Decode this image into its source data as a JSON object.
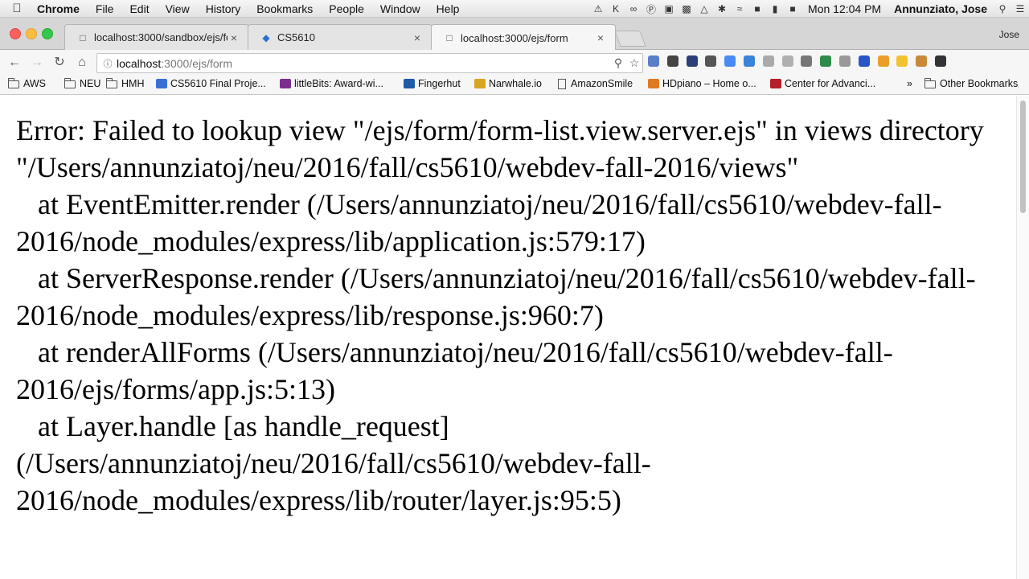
{
  "menubar": {
    "items": [
      "Chrome",
      "File",
      "Edit",
      "View",
      "History",
      "Bookmarks",
      "People",
      "Window",
      "Help"
    ],
    "clock": "Mon 12:04 PM",
    "user": "Annunziato, Jose"
  },
  "tabs": [
    {
      "title": "localhost:3000/sandbox/ejs/fo",
      "active": false
    },
    {
      "title": "CS5610",
      "active": false
    },
    {
      "title": "localhost:3000/ejs/form",
      "active": true
    }
  ],
  "profile": "Jose",
  "address": {
    "host": "localhost",
    "path": ":3000/ejs/form"
  },
  "bookmarks": [
    {
      "label": "AWS",
      "icon": "folder-icon"
    },
    {
      "label": "NEU",
      "icon": "folder-icon"
    },
    {
      "label": "HMH",
      "icon": "folder-icon"
    },
    {
      "label": "CS5610 Final Proje...",
      "icon": "docs-icon"
    },
    {
      "label": "littleBits: Award-wi...",
      "icon": "littlebits-icon"
    },
    {
      "label": "Fingerhut",
      "icon": "fingerhut-icon"
    },
    {
      "label": "Narwhale.io",
      "icon": "narwhale-icon"
    },
    {
      "label": "AmazonSmile",
      "icon": "page-icon"
    },
    {
      "label": "HDpiano – Home o...",
      "icon": "hdpiano-icon"
    },
    {
      "label": "Center for Advanci...",
      "icon": "n-icon"
    },
    {
      "label": "»",
      "icon": "overflow-chevron-icon"
    },
    {
      "label": "Other Bookmarks",
      "icon": "folder-icon"
    }
  ],
  "error_text": "Error: Failed to lookup view \"/ejs/form/form-list.view.server.ejs\" in views directory \"/Users/annunziatoj/neu/2016/fall/cs5610/webdev-fall-2016/views\"\n   at EventEmitter.render (/Users/annunziatoj/neu/2016/fall/cs5610/webdev-fall-2016/node_modules/express/lib/application.js:579:17)\n   at ServerResponse.render (/Users/annunziatoj/neu/2016/fall/cs5610/webdev-fall-2016/node_modules/express/lib/response.js:960:7)\n   at renderAllForms (/Users/annunziatoj/neu/2016/fall/cs5610/webdev-fall-2016/ejs/forms/app.js:5:13)\n   at Layer.handle [as handle_request] (/Users/annunziatoj/neu/2016/fall/cs5610/webdev-fall-2016/node_modules/express/lib/router/layer.js:95:5)",
  "colors": {
    "extensions": [
      "#5a7fc7",
      "#444444",
      "#2c3e7a",
      "#555555",
      "#4a8af4",
      "#3b83d9",
      "#aaaaaa",
      "#b0b0b0",
      "#777777",
      "#2f8a4c",
      "#999999",
      "#2a55c8",
      "#e8a02a",
      "#f2c230",
      "#c88a3a",
      "#333333"
    ]
  }
}
